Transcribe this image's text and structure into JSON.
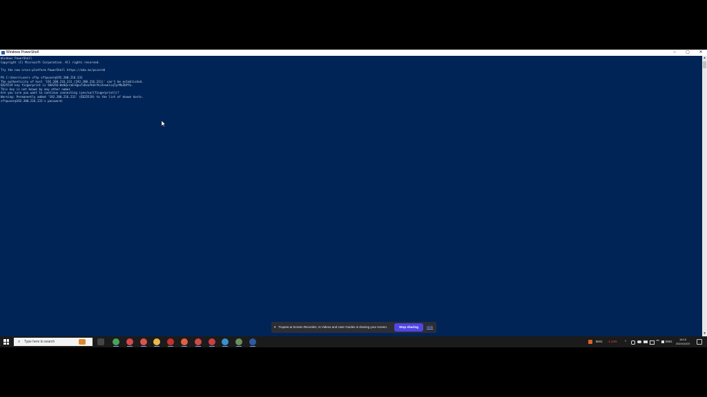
{
  "window": {
    "title": "Windows PowerShell",
    "minimize_glyph": "–",
    "maximize_glyph": "▢",
    "close_glyph": "✕"
  },
  "console": {
    "lines": [
      "Windows PowerShell",
      "Copyright (C) Microsoft Corporation. All rights reserved.",
      "",
      "Try the new cross-platform PowerShell https://aka.ms/pscore6",
      "",
      "PS C:\\Users\\user> sftp sftpuser@192.200.216.231",
      "The authenticity of host '192.200.216.231 (192.200.216.231)' can't be established.",
      "ED25519 key fingerprint is SHA256:Wz6QcraE+QpuTcKzaYkU+YkiX+welcqTyrMkZbPfo.",
      "This key is not known by any other names",
      "Are you sure you want to continue connecting (yes/no/[fingerprint])? ",
      "Warning: Permanently added '192.200.216.231' (ED25519) to the list of known hosts.",
      "sftpuser@192.200.216.231's password:"
    ]
  },
  "share_bar": {
    "pause_icon": "⏸",
    "message": "Trupeer.ai Screen Recorder, AI Videos and User Guides is sharing your screen.",
    "stop_label": "Stop sharing",
    "hide_label": "Hide"
  },
  "taskbar": {
    "search_placeholder": "Type here to search",
    "search_icon": "⌕",
    "stock_name": "BHG",
    "stock_change": "-1.24%",
    "language": "ENG",
    "time": "18:15",
    "date": "2024/10/23",
    "tray_chevron": "^",
    "colors": {
      "stock_negative": "#e05050",
      "active_underline": "#7aa7e6"
    },
    "apps": [
      {
        "name": "task-view-icon",
        "color": "#444"
      },
      {
        "name": "chrome-icon",
        "color": "#4aa35a"
      },
      {
        "name": "red-app-icon",
        "color": "#d24a4a"
      },
      {
        "name": "chrome-profile-icon",
        "color": "#d9534f"
      },
      {
        "name": "file-explorer-icon",
        "color": "#e8b84a"
      },
      {
        "name": "acrobat-icon",
        "color": "#c9302c"
      },
      {
        "name": "app-red-2-icon",
        "color": "#e06040"
      },
      {
        "name": "app-red-3-icon",
        "color": "#d04848"
      },
      {
        "name": "app-red-4-icon",
        "color": "#c84040"
      },
      {
        "name": "network-app-icon",
        "color": "#3a8fd0"
      },
      {
        "name": "photos-icon",
        "color": "#6a8f5a"
      },
      {
        "name": "powershell-icon",
        "color": "#2b5aa8"
      }
    ]
  }
}
